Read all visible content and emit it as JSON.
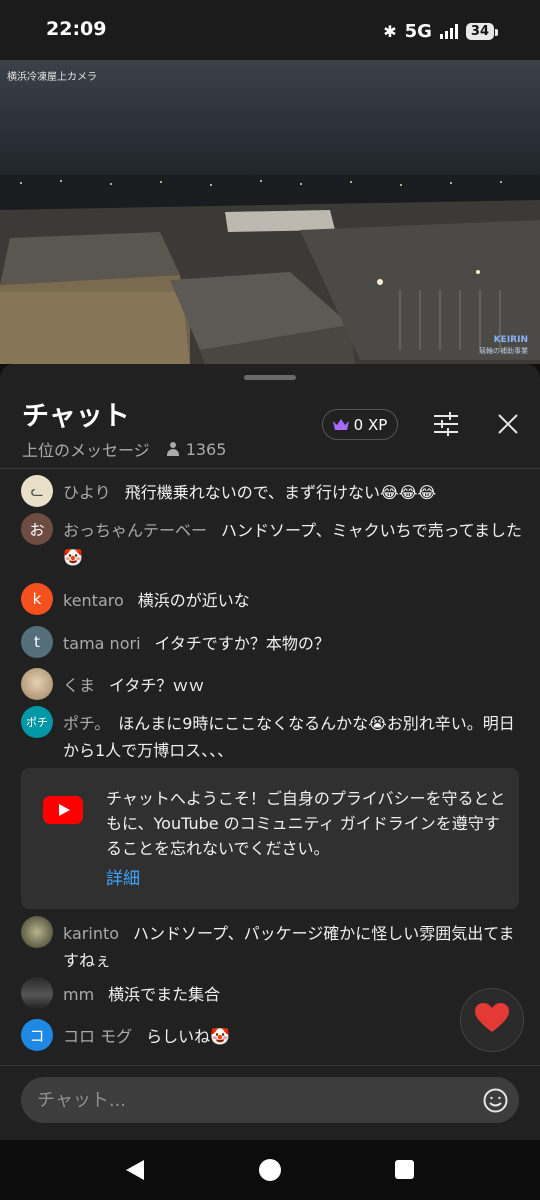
{
  "status_bar": {
    "time": "22:09",
    "network": "5G",
    "battery": "34"
  },
  "video": {
    "caption": "横浜冷凍屋上カメラ",
    "watermark_title": "KEIRIN",
    "watermark_sub": "競輪の補助事業"
  },
  "chat": {
    "title": "チャット",
    "mode": "上位のメッセージ",
    "viewer_count": "1365",
    "xp_label": "0 XP",
    "messages": [
      {
        "author": "ひより",
        "text": "飛行機乗れないので、まず行けない😂😂😂",
        "avatar_letter": "",
        "avatar_color": "#e8e0c8"
      },
      {
        "author": "おっちゃんテーベー",
        "text": "ハンドソープ、ミャクいちで売ってました🤡",
        "avatar_letter": "お",
        "avatar_color": "#6d4c41"
      },
      {
        "author": "kentaro",
        "text": "横浜のが近いな",
        "avatar_letter": "k",
        "avatar_color": "#f4511e"
      },
      {
        "author": "tama nori",
        "text": "イタチですか？本物の？",
        "avatar_letter": "t",
        "avatar_color": "#546e7a"
      },
      {
        "author": "くま",
        "text": "イタチ？ｗｗ",
        "avatar_letter": "",
        "avatar_color": "#c9b79a"
      },
      {
        "author": "ポチ。",
        "text": "ほんまに9時にここなくなるんかな😭お別れ辛い。明日から1人で万博ロス、、、",
        "avatar_letter": "ポチ",
        "avatar_color": "#0097a7"
      },
      {
        "author": "karinto",
        "text": "ハンドソープ、パッケージ確かに怪しい雰囲気出てますねぇ",
        "avatar_letter": "",
        "avatar_color": "#8d8a6a"
      },
      {
        "author": "mm",
        "text": "横浜でまた集合",
        "avatar_letter": "",
        "avatar_color": "#3a3a3a"
      },
      {
        "author": "コロ モグ",
        "text": "らしいね🤡",
        "avatar_letter": "コ",
        "avatar_color": "#1e88e5"
      }
    ],
    "welcome": {
      "text": "チャットへようこそ！ご自身のプライバシーを守るとともに、YouTube のコミュニティ ガイドラインを遵守することを忘れないでください。",
      "link": "詳細"
    },
    "input_placeholder": "チャット...",
    "reaction": "❤️"
  },
  "colors": {
    "accent_link": "#3ea6ff",
    "youtube_red": "#ff0000",
    "xp_crown": "#a66cff",
    "heart": "#e53935"
  }
}
